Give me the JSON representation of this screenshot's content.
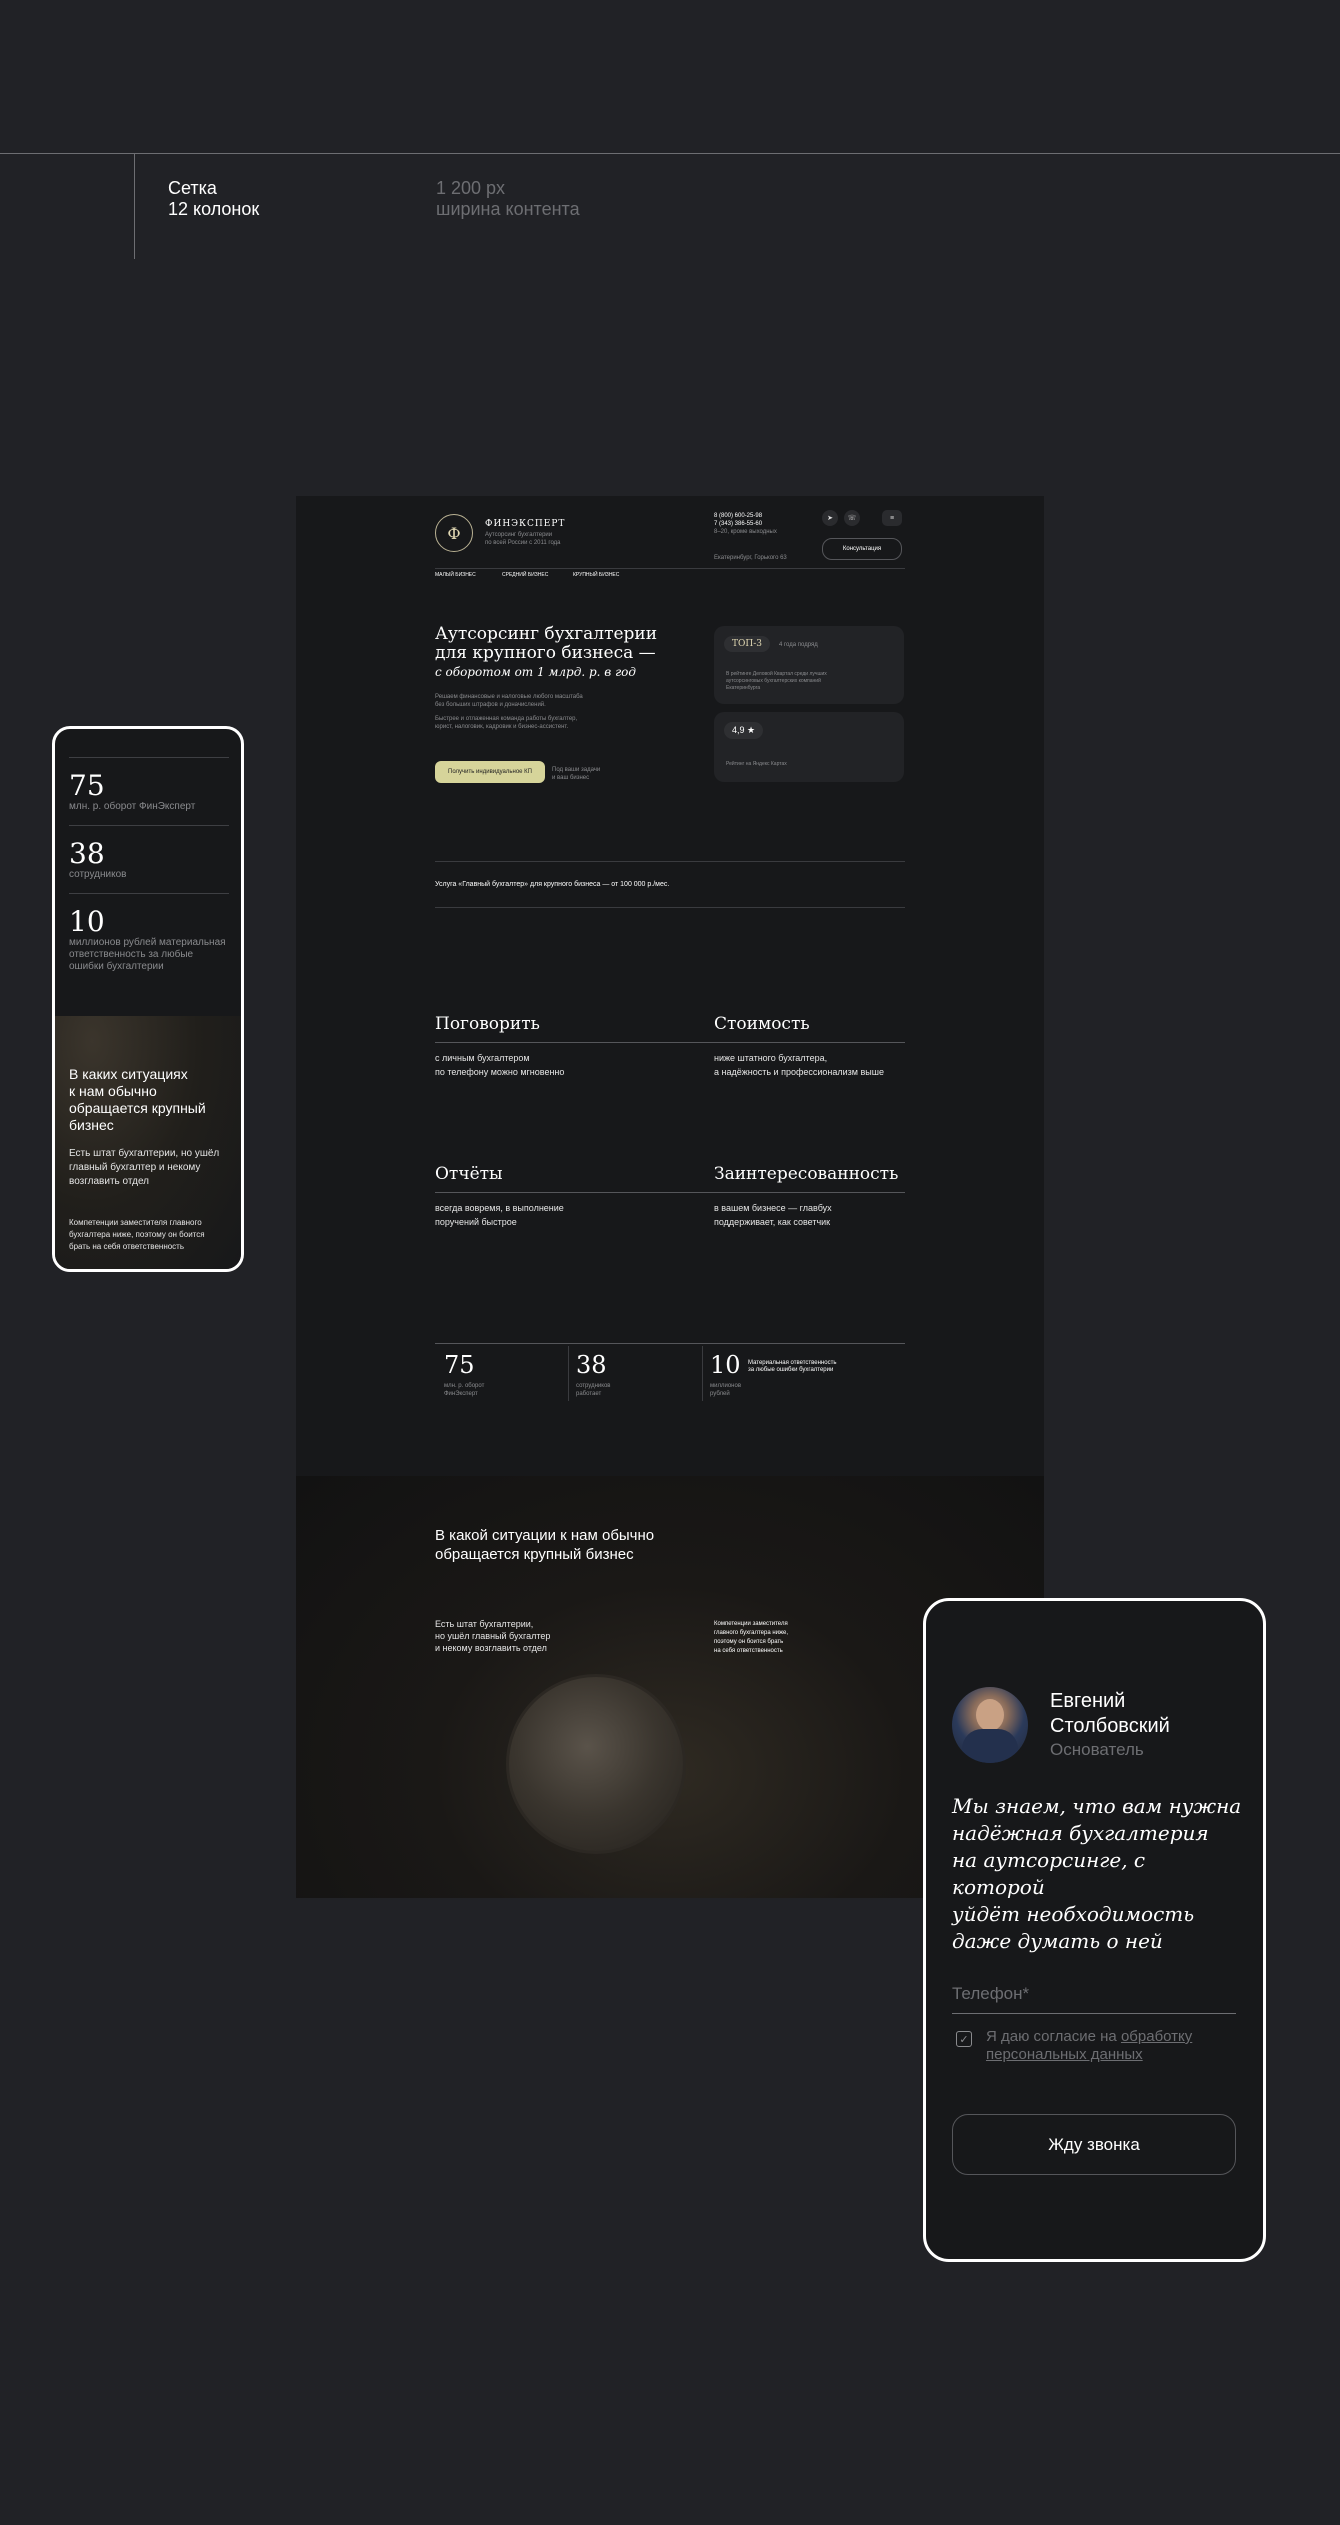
{
  "spec": {
    "grid_label_1": "Сетка",
    "grid_label_2": "12 колонок",
    "width_label_1": "1 200 px",
    "width_label_2": "ширина контента"
  },
  "desktop": {
    "logo_letter": "Ф",
    "brand": "ФИНЭКСПЕРТ",
    "brand_sub_1": "Аутсорсинг бухгалтерии",
    "brand_sub_2": "по всей России с 2011 года",
    "phone_1": "8 (800) 600-25-98",
    "phone_2": "7 (343) 386-55-60",
    "hours": "8–20, кроме выходных",
    "address": "Екатеринбург, Горького 63",
    "consult_button": "Консультация",
    "nav": [
      "МАЛЫЙ БИЗНЕС",
      "СРЕДНИЙ БИЗНЕС",
      "КРУПНЫЙ БИЗНЕС"
    ],
    "hero_title_1": "Аутсорсинг бухгалтерии",
    "hero_title_2": "для крупного бизнеса —",
    "hero_title_3": "с оборотом от 1 млрд. р. в год",
    "hero_text_1": "Решаем финансовые и налоговые любого масштаба",
    "hero_text_2": "без больших штрафов и доначислений.",
    "hero_text_3": "Быстрее и отлаженная команда работы бухгалтер,",
    "hero_text_4": "юрист, налоговик, кадровик и бизнес-ассистент.",
    "cta_button": "Получить индивидуальное КП",
    "cta_note_1": "Под ваши задачи",
    "cta_note_2": "и ваш бизнес",
    "card_top_badge": "ТОП-3",
    "card_top_label": "4 года подряд",
    "card_top_text_1": "В рейтинге Деловой Квартал среди лучших",
    "card_top_text_2": "аутсорсинговых бухгалтерских компаний",
    "card_top_text_3": "Екатеринбурга",
    "card_rating_value": "4,9 ★",
    "card_rating_text": "Рейтинг на Яндекс Картах",
    "service_line": "Услуга «Главный бухгалтер» для крупного бизнеса — от 100 000 р./мес.",
    "features": [
      {
        "title": "Поговорить",
        "text_1": "с личным бухгалтером",
        "text_2": "по телефону можно мгновенно"
      },
      {
        "title": "Стоимость",
        "text_1": "ниже штатного бухгалтера,",
        "text_2": "а надёжность и профессионализм выше"
      },
      {
        "title": "Отчёты",
        "text_1": "всегда вовремя, в выполнение",
        "text_2": "поручений быстрое"
      },
      {
        "title": "Заинтересованность",
        "text_1": "в вашем бизнесе — главбух",
        "text_2": "поддерживает, как советчик"
      }
    ],
    "stats": [
      {
        "num": "75",
        "label_1": "млн. р. оборот",
        "label_2": "ФинЭксперт"
      },
      {
        "num": "38",
        "label_1": "сотрудников",
        "label_2": "работает"
      },
      {
        "num": "10",
        "label_1": "миллионов",
        "label_2": "рублей"
      }
    ],
    "stat_extra_1": "Материальная ответственность",
    "stat_extra_2": "за любые ошибки бухгалтерии",
    "situation_title_1": "В какой ситуации к нам обычно",
    "situation_title_2": "обращается крупный бизнес",
    "situation_left_1": "Есть штат бухгалтерии,",
    "situation_left_2": "но ушёл главный бухгалтер",
    "situation_left_3": "и некому возглавить отдел",
    "situation_right_1": "Компетенции заместителя",
    "situation_right_2": "главного бухгалтера ниже,",
    "situation_right_3": "поэтому он боится брать",
    "situation_right_4": "на себя ответственность"
  },
  "phone_small": {
    "stats": [
      {
        "num": "75",
        "label": "млн. р. оборот ФинЭксперт"
      },
      {
        "num": "38",
        "label": "сотрудников"
      },
      {
        "num": "10",
        "label_1": "миллионов рублей материальная",
        "label_2": "ответственность за любые",
        "label_3": "ошибки бухгалтерии"
      }
    ],
    "title_1": "В каких ситуациях",
    "title_2": "к нам обычно",
    "title_3": "обращается крупный",
    "title_4": "бизнес",
    "text_1": "Есть штат бухгалтерии, но ушёл",
    "text_2": "главный бухгалтер и некому",
    "text_3": "возглавить отдел",
    "text2_1": "Компетенции заместителя главного",
    "text2_2": "бухгалтера ниже, поэтому он боится",
    "text2_3": "брать на себя ответственность"
  },
  "phone_large": {
    "name_1": "Евгений",
    "name_2": "Столбовский",
    "role": "Основатель",
    "quote_1": "Мы знаем, что вам нужна",
    "quote_2": "надёжная бухгалтерия",
    "quote_3": "на аутсорсинге, с которой",
    "quote_4": "уйдёт необходимость",
    "quote_5": "даже думать о ней",
    "phone_placeholder": "Телефон*",
    "consent_1": "Я даю согласие на",
    "consent_link_1": "обработку",
    "consent_link_2": "персональных данных",
    "submit": "Жду звонка"
  }
}
